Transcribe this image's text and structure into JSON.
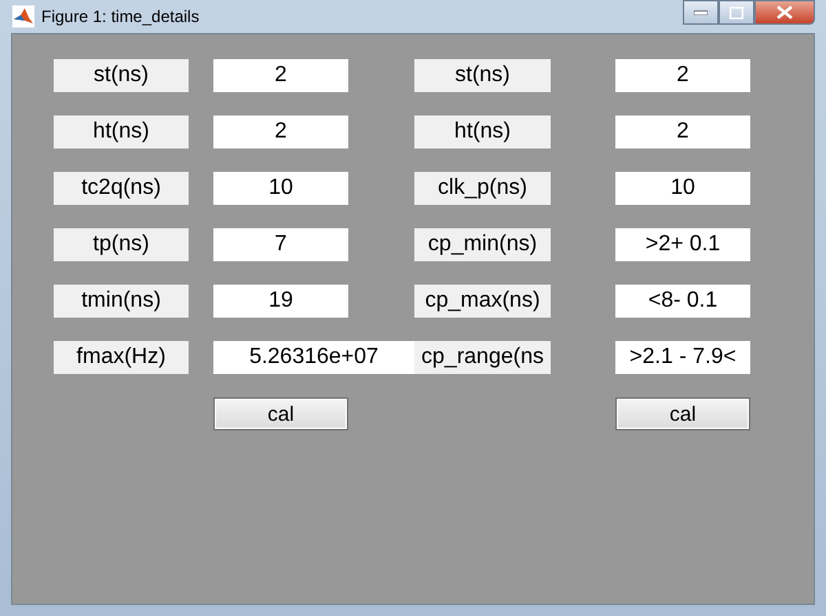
{
  "window": {
    "title": "Figure 1: time_details"
  },
  "rows": [
    {
      "left": {
        "label": "st(ns)",
        "value": "2"
      },
      "right": {
        "label": "st(ns)",
        "value": "2"
      }
    },
    {
      "left": {
        "label": "ht(ns)",
        "value": "2"
      },
      "right": {
        "label": "ht(ns)",
        "value": "2"
      }
    },
    {
      "left": {
        "label": "tc2q(ns)",
        "value": "10"
      },
      "right": {
        "label": "clk_p(ns)",
        "value": "10"
      }
    },
    {
      "left": {
        "label": "tp(ns)",
        "value": "7"
      },
      "right": {
        "label": "cp_min(ns)",
        "value": ">2+ 0.1"
      }
    },
    {
      "left": {
        "label": "tmin(ns)",
        "value": "19"
      },
      "right": {
        "label": "cp_max(ns)",
        "value": "<8- 0.1"
      }
    },
    {
      "left": {
        "label": "fmax(Hz)",
        "value": "5.26316e+07"
      },
      "right": {
        "label": "cp_range(ns",
        "value": ">2.1 - 7.9<"
      }
    }
  ],
  "buttons": [
    "cal",
    "cal"
  ]
}
